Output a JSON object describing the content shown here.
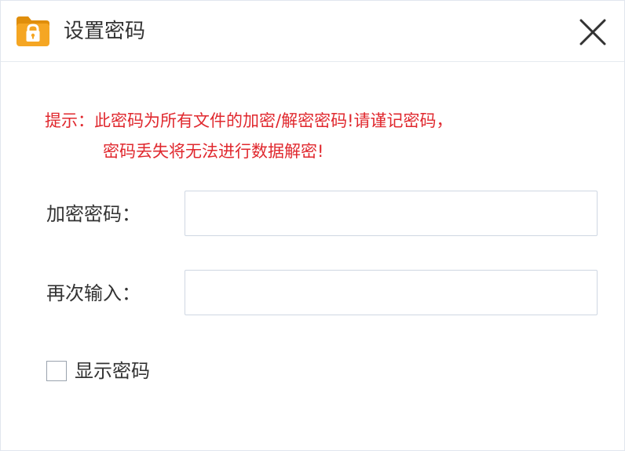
{
  "window": {
    "title": "设置密码"
  },
  "icons": {
    "app": "locked-folder-icon",
    "close": "close-icon",
    "checkbox": "checkbox-unchecked"
  },
  "hint": {
    "line1": "提示：此密码为所有文件的加密/解密密码!请谨记密码，",
    "line2": "密码丢失将无法进行数据解密!",
    "color": "#e0282e"
  },
  "form": {
    "password_label": "加密密码：",
    "password_value": "",
    "confirm_label": "再次输入：",
    "confirm_value": ""
  },
  "show_password": {
    "label": "显示密码",
    "checked": false
  },
  "colors": {
    "folder": "#f5a623",
    "folder_dark": "#e08e0b",
    "lock": "#ffffff",
    "close_x": "#333333"
  }
}
